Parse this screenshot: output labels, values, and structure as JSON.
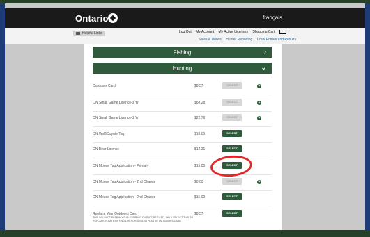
{
  "header": {
    "logo_text": "Ontario",
    "lang_link": "français"
  },
  "utility": {
    "helpful_links": "Helpful Links",
    "top_links": [
      "Log Out",
      "My Account",
      "My Active Licenses",
      "Shopping Cart"
    ],
    "sub_links": [
      "Sales & Draws",
      "Hunter Reporting",
      "Draw Entries and Results"
    ]
  },
  "sections": {
    "fishing": "Fishing",
    "hunting": "Hunting"
  },
  "products": [
    {
      "name": "Outdoors Card",
      "price": "$8.57",
      "button": "SELECT",
      "state": "disabled",
      "info": true
    },
    {
      "name": "ON Small Game Licence-3 Yr",
      "price": "$68.28",
      "button": "SELECT",
      "state": "disabled",
      "info": true
    },
    {
      "name": "ON Small Game Licence-1 Yr",
      "price": "$22.76",
      "button": "SELECT",
      "state": "disabled",
      "info": true
    },
    {
      "name": "ON Wolf/Coyote Tag",
      "price": "$10.05",
      "button": "SELECT",
      "state": "active",
      "info": false
    },
    {
      "name": "ON Bear Licence",
      "price": "$12.21",
      "button": "SELECT",
      "state": "active",
      "info": false
    },
    {
      "name": "ON Moose Tag Application - Primary",
      "price": "$15.00",
      "button": "SELECT",
      "state": "active",
      "info": false
    },
    {
      "name": "ON Moose Tag Application - 2nd Chance",
      "price": "$0.00",
      "button": "SELECT",
      "state": "disabled",
      "info": true
    },
    {
      "name": "ON Moose Tag Application - 2nd Chance",
      "price": "$15.00",
      "button": "SELECT",
      "state": "active",
      "info": false
    },
    {
      "name": "Replace Your Outdoors Card",
      "price": "$8.57",
      "button": "SELECT",
      "state": "active",
      "info": false,
      "note": "THIS WILL NOT RENEW YOUR EXPIRING OUTDOORS CARD. ONLY SELECT THIS TO REPLACE YOUR EXISTING LOST OR STOLEN PLASTIC OUTDOORS CARD"
    }
  ],
  "colors": {
    "brand_green": "#2f5a3c",
    "highlight_red": "#e3262a",
    "header_dark": "#1a1a1a"
  }
}
